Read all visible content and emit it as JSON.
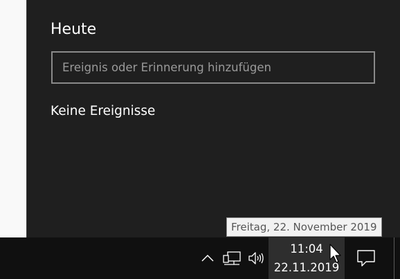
{
  "calendar": {
    "title": "Heute",
    "input_placeholder": "Ereignis oder Erinnerung hinzufügen",
    "empty_text": "Keine Ereignisse"
  },
  "tooltip": {
    "text": "Freitag, 22. November 2019"
  },
  "taskbar": {
    "time": "11:04",
    "date": "22.11.2019",
    "icons": [
      "chevron-up-icon",
      "network-icon",
      "volume-icon",
      "action-center-icon"
    ]
  },
  "colors": {
    "panel_bg": "#1f1f1f",
    "taskbar_bg": "#101010",
    "clock_highlight": "#2e2e2e"
  }
}
